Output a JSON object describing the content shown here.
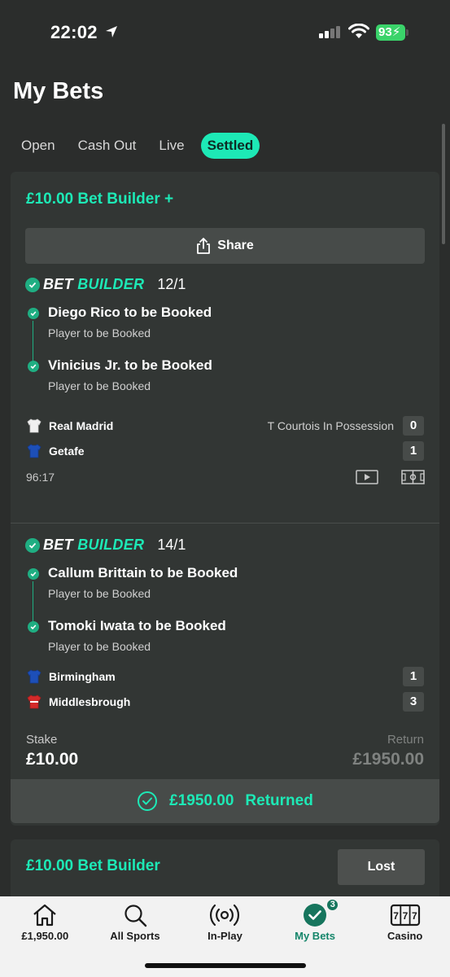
{
  "status_bar": {
    "time": "22:02",
    "battery": "93"
  },
  "page": {
    "title": "My Bets"
  },
  "tabs": [
    {
      "label": "Open",
      "active": false
    },
    {
      "label": "Cash Out",
      "active": false
    },
    {
      "label": "Live",
      "active": false
    },
    {
      "label": "Settled",
      "active": true
    }
  ],
  "bet1": {
    "header": "£10.00 Bet Builder +",
    "share_label": "Share",
    "builders": [
      {
        "logo_part1": "BET",
        "logo_part2": "BUILDER",
        "odds": "12/1",
        "legs": [
          {
            "title": "Diego Rico to be Booked",
            "sub": "Player to be Booked"
          },
          {
            "title": "Vinicius Jr. to be Booked",
            "sub": "Player to be Booked"
          }
        ],
        "teams": [
          {
            "name": "Real Madrid",
            "score": "0"
          },
          {
            "name": "Getafe",
            "score": "1"
          }
        ],
        "possession": "T Courtois In Possession",
        "match_time": "96:17"
      },
      {
        "logo_part1": "BET",
        "logo_part2": "BUILDER",
        "odds": "14/1",
        "legs": [
          {
            "title": "Callum Brittain to be Booked",
            "sub": "Player to be Booked"
          },
          {
            "title": "Tomoki Iwata to be Booked",
            "sub": "Player to be Booked"
          }
        ],
        "teams": [
          {
            "name": "Birmingham",
            "score": "1"
          },
          {
            "name": "Middlesbrough",
            "score": "3"
          }
        ]
      }
    ],
    "stake_label": "Stake",
    "stake_value": "£10.00",
    "return_label": "Return",
    "return_value": "£1950.00",
    "returned_amount": "£1950.00",
    "returned_label": "Returned"
  },
  "bet2": {
    "header": "£10.00 Bet Builder",
    "status": "Lost"
  },
  "nav": [
    {
      "label": "£1,950.00",
      "icon": "home-icon"
    },
    {
      "label": "All Sports",
      "icon": "search-icon"
    },
    {
      "label": "In-Play",
      "icon": "broadcast-icon"
    },
    {
      "label": "My Bets",
      "icon": "check-circle-icon",
      "badge": "3",
      "active": true
    },
    {
      "label": "Casino",
      "icon": "slot-machine-icon"
    }
  ],
  "colors": {
    "accent": "#1de9b6",
    "background": "#2b2d2c",
    "card": "#323634",
    "active_nav": "#14856a"
  }
}
